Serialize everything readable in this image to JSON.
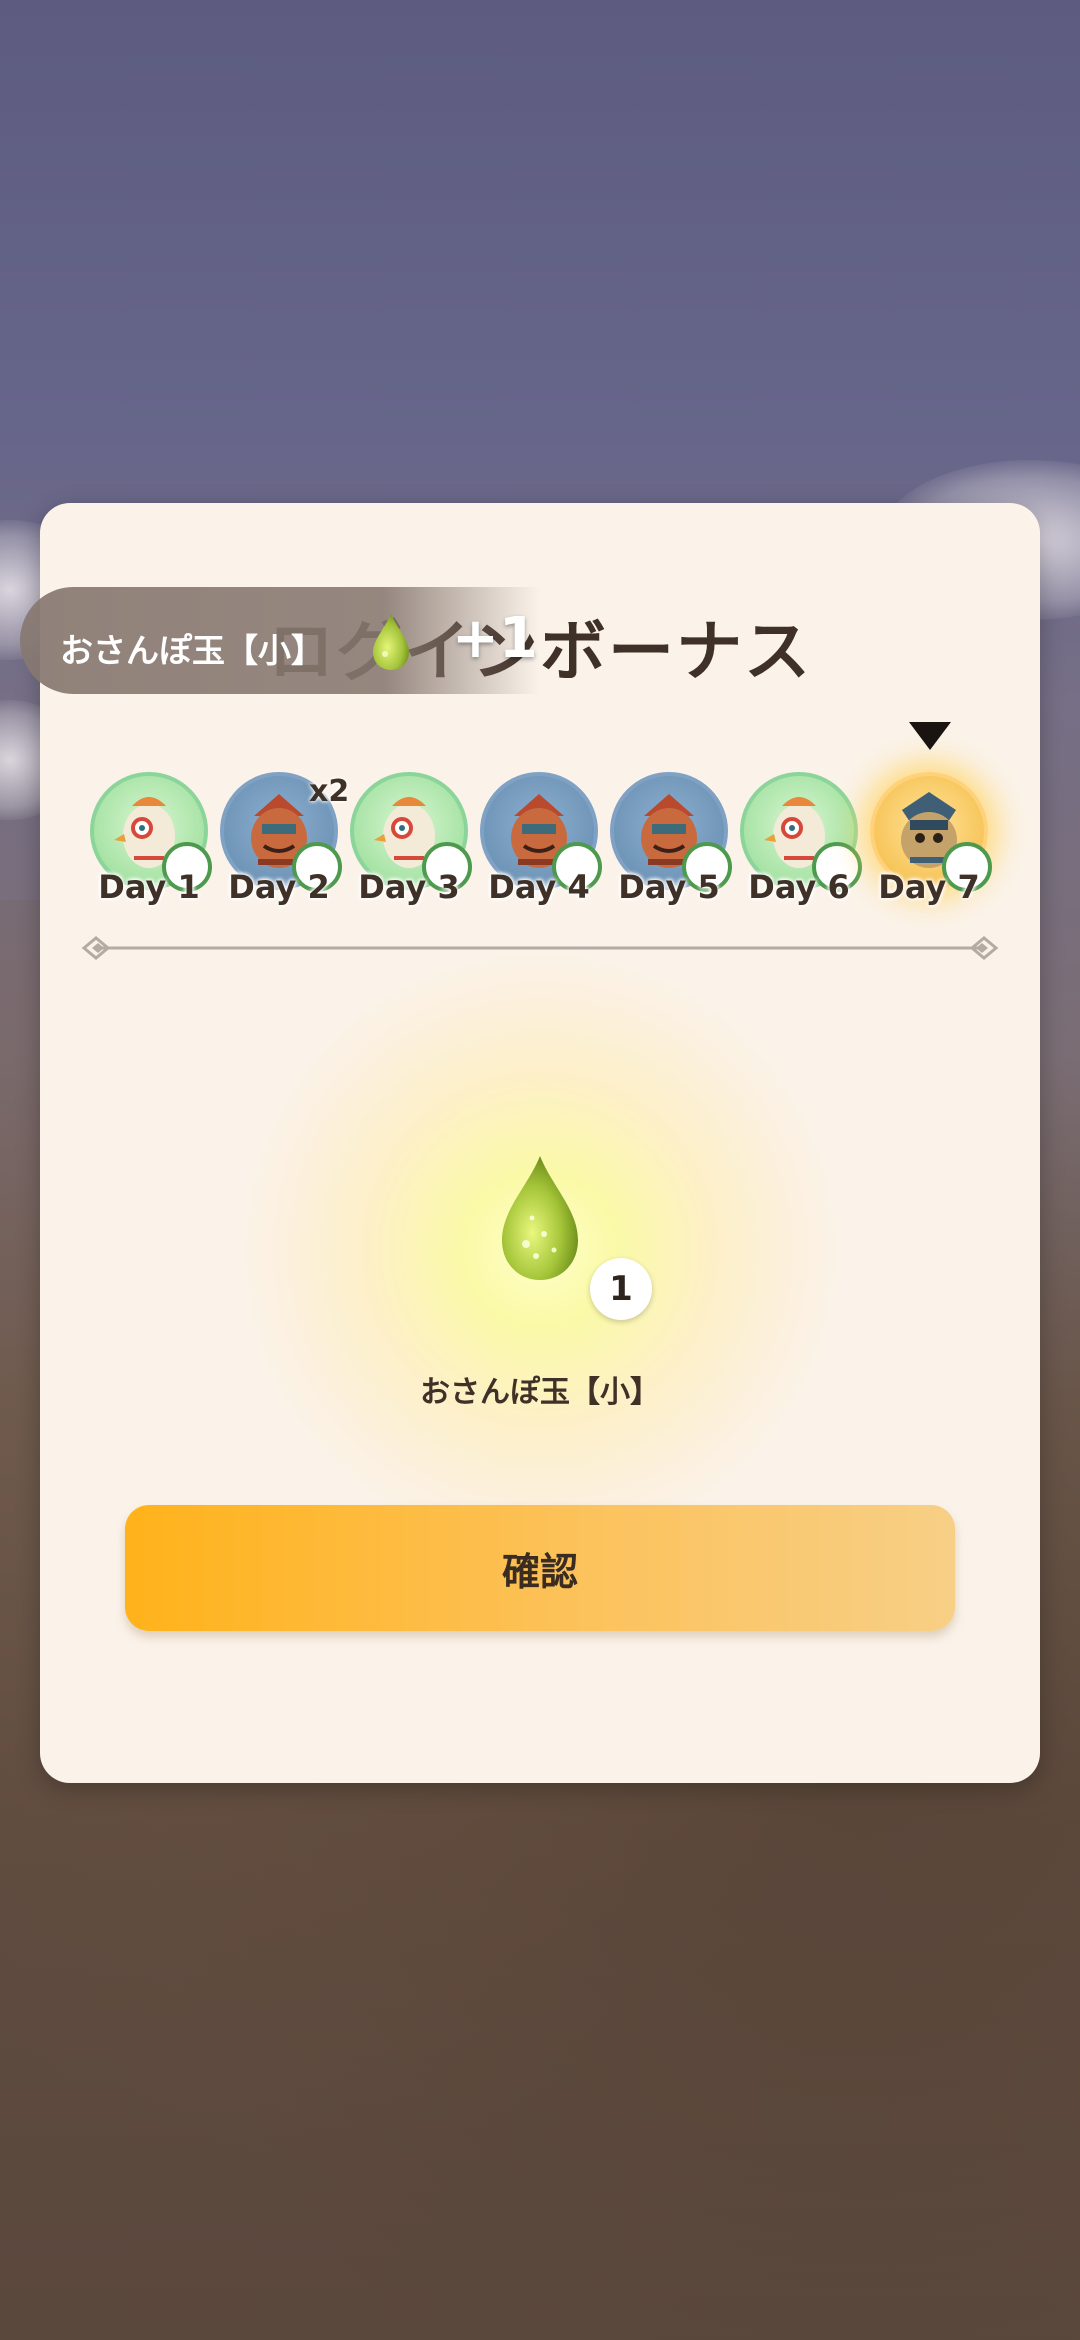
{
  "modal": {
    "title": "ログインボーナス",
    "days": [
      {
        "label": "Day 1",
        "icon": "bird-character-icon",
        "theme": "green"
      },
      {
        "label": "Day 2",
        "icon": "bear-character-icon",
        "theme": "blue",
        "multiplier": "x2"
      },
      {
        "label": "Day 3",
        "icon": "bird-character-icon",
        "theme": "green"
      },
      {
        "label": "Day 4",
        "icon": "bear-character-icon",
        "theme": "blue"
      },
      {
        "label": "Day 5",
        "icon": "bear-character-icon",
        "theme": "blue"
      },
      {
        "label": "Day 6",
        "icon": "bird-character-icon",
        "theme": "green"
      },
      {
        "label": "Day 7",
        "icon": "owl-character-icon",
        "theme": "gold",
        "current": true
      }
    ],
    "reward": {
      "name": "おさんぽ玉【小】",
      "count": "1",
      "icon": "green-drop-icon"
    },
    "confirm_label": "確認"
  },
  "toast": {
    "item_name": "おさんぽ玉【小】",
    "increment": "+1",
    "icon": "green-drop-icon"
  },
  "colors": {
    "modal_bg": "#fbf3ea",
    "title_text": "#3f3128",
    "button_start": "#ffb21a",
    "button_end": "#f7cf86",
    "paw_badge": "#4d9a4f"
  }
}
